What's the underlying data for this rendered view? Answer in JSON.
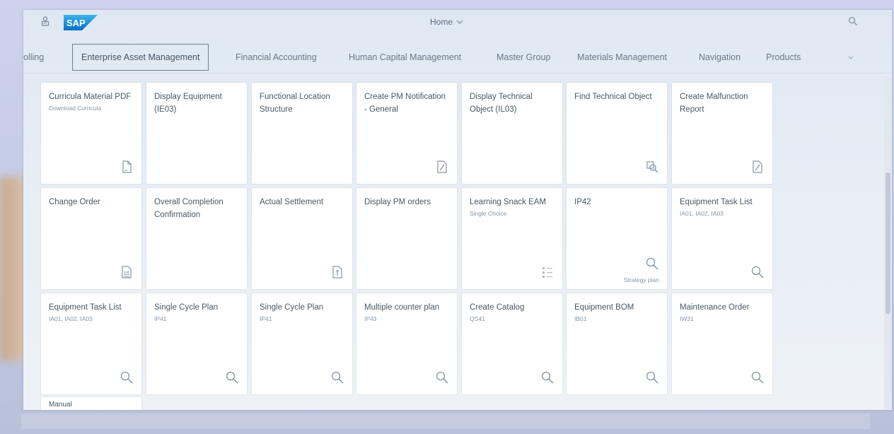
{
  "shell": {
    "title": "Home",
    "logo_text": "SAP"
  },
  "tabs": [
    {
      "label": "olling",
      "selected": false
    },
    {
      "label": "Enterprise Asset Management",
      "selected": true
    },
    {
      "label": "Financial Accounting",
      "selected": false
    },
    {
      "label": "Human Capital Management",
      "selected": false
    },
    {
      "label": "Master Group",
      "selected": false
    },
    {
      "label": "Materials Management",
      "selected": false
    },
    {
      "label": "Navigation",
      "selected": false
    },
    {
      "label": "Products",
      "selected": false
    }
  ],
  "tiles": [
    {
      "title": "Curricula Material PDF",
      "subtitle": "Download Curricula",
      "icon": "document-icon",
      "footer": ""
    },
    {
      "title": "Display Equipment (IE03)",
      "subtitle": "",
      "icon": "",
      "footer": ""
    },
    {
      "title": "Functional Location Structure",
      "subtitle": "",
      "icon": "",
      "footer": ""
    },
    {
      "title": "Create PM Notification - General",
      "subtitle": "",
      "icon": "edit-document-icon",
      "footer": ""
    },
    {
      "title": "Display Technical Object (IL03)",
      "subtitle": "",
      "icon": "",
      "footer": ""
    },
    {
      "title": "Find Technical Object",
      "subtitle": "",
      "icon": "find-object-icon",
      "footer": ""
    },
    {
      "title": "Create Malfunction Report",
      "subtitle": "",
      "icon": "edit-document-icon",
      "footer": ""
    },
    {
      "title": "Change Order",
      "subtitle": "",
      "icon": "order-document-icon",
      "footer": ""
    },
    {
      "title": "Overall Completion Confirmation",
      "subtitle": "",
      "icon": "",
      "footer": ""
    },
    {
      "title": "Actual Settlement",
      "subtitle": "",
      "icon": "settlement-document-icon",
      "footer": ""
    },
    {
      "title": "Display PM orders",
      "subtitle": "",
      "icon": "",
      "footer": ""
    },
    {
      "title": "Learning Snack EAM",
      "subtitle": "Single Choice",
      "icon": "list-icon",
      "footer": ""
    },
    {
      "title": "IP42",
      "subtitle": "",
      "icon": "search-icon",
      "footer": "Strategy plan"
    },
    {
      "title": "Equipment Task List",
      "subtitle": "IA01, IA02, IA03",
      "icon": "search-icon",
      "footer": ""
    },
    {
      "title": "Equipment Task List",
      "subtitle": "IA01, IA02, IA03",
      "icon": "search-icon",
      "footer": ""
    },
    {
      "title": "Single Cycle Plan",
      "subtitle": "IP41",
      "icon": "search-icon",
      "footer": ""
    },
    {
      "title": "Single Cycle Plan",
      "subtitle": "IP41",
      "icon": "search-icon",
      "footer": ""
    },
    {
      "title": "Multiple counter plan",
      "subtitle": "IP43",
      "icon": "search-icon",
      "footer": ""
    },
    {
      "title": "Create Catalog",
      "subtitle": "QS41",
      "icon": "search-icon",
      "footer": ""
    },
    {
      "title": "Equipment BOM",
      "subtitle": "IB01",
      "icon": "search-icon",
      "footer": ""
    },
    {
      "title": "Maintenance Order",
      "subtitle": "IW31",
      "icon": "search-icon",
      "footer": ""
    }
  ],
  "partial_tile": {
    "title": "Manual"
  },
  "colors": {
    "accent": "#1a9ee0",
    "tile_text": "#4a5866",
    "background": "#e6edf5"
  }
}
